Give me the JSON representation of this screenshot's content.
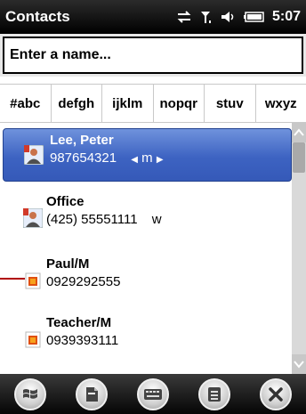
{
  "titlebar": {
    "title": "Contacts",
    "time": "5:07",
    "icons": [
      "data-sync-icon",
      "signal-icon",
      "volume-icon",
      "battery-icon"
    ]
  },
  "search": {
    "placeholder": "Enter a name..."
  },
  "tabs": [
    "#abc",
    "defgh",
    "ijklm",
    "nopqr",
    "stuv",
    "wxyz"
  ],
  "contacts": [
    {
      "name": "Lee, Peter",
      "phone": "987654321",
      "type": "m",
      "selected": true,
      "icon": "contact-photo-icon"
    },
    {
      "name": "Office",
      "phone": "(425) 55551111",
      "type": "w",
      "selected": false,
      "icon": "contact-photo-icon"
    },
    {
      "name": "Paul/M",
      "phone": "0929292555",
      "type": "",
      "selected": false,
      "icon": "sim-contact-icon"
    },
    {
      "name": "Teacher/M",
      "phone": "0939393111",
      "type": "",
      "selected": false,
      "icon": "sim-contact-icon"
    }
  ],
  "softkeys": [
    "windows-start-icon",
    "new-contact-icon",
    "keyboard-icon",
    "menu-icon",
    "close-icon"
  ],
  "colors": {
    "selection": "#3d63c2",
    "titlebar": "#000000",
    "sim_icon": "#e05010"
  }
}
